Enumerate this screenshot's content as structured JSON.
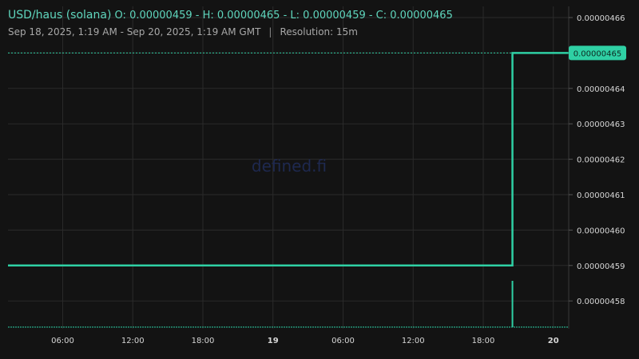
{
  "header": {
    "symbol": "USD/haus (solana)",
    "ohlc": "O: 0.00000459 - H: 0.00000465 - L: 0.00000459 - C: 0.00000465",
    "range": "Sep 18, 2025, 1:19 AM - Sep 20, 2025, 1:19 AM GMT",
    "separator": "|",
    "resolution": "Resolution: 15m"
  },
  "watermark": "defined.fi",
  "colors": {
    "background": "#131313",
    "grid": "#2b2b2b",
    "accent": "#2fd0a4",
    "axis_text": "#d6d6d6",
    "watermark": "#1e2950"
  },
  "chart_data": {
    "type": "line",
    "title": "USD/haus (solana)",
    "y_ticks": [
      "0.00000466",
      "0.00000465",
      "0.00000464",
      "0.00000463",
      "0.00000462",
      "0.00000461",
      "0.00000460",
      "0.00000459",
      "0.00000458"
    ],
    "x_ticks": [
      {
        "label": "06:00",
        "bold": false
      },
      {
        "label": "12:00",
        "bold": false
      },
      {
        "label": "18:00",
        "bold": false
      },
      {
        "label": "19",
        "bold": true
      },
      {
        "label": "06:00",
        "bold": false
      },
      {
        "label": "12:00",
        "bold": false
      },
      {
        "label": "18:00",
        "bold": false
      },
      {
        "label": "20",
        "bold": true
      }
    ],
    "last_price_label": "0.00000465",
    "price_series": {
      "name": "",
      "points": [
        {
          "x": "Sep 18, 2025, 1:19 AM",
          "y": 4.59e-06
        },
        {
          "x": "Sep 19, 2025, 8:30 PM",
          "y": 4.59e-06
        },
        {
          "x": "Sep 19, 2025, 8:30 PM",
          "y": 4.65e-06
        },
        {
          "x": "Sep 20, 2025, 1:19 AM",
          "y": 4.65e-06
        }
      ]
    },
    "volume_spikes": [
      {
        "x": "Sep 19, 2025, 8:30 PM",
        "relative": 1.0
      }
    ],
    "grid": true,
    "y_axis_position": "right"
  }
}
